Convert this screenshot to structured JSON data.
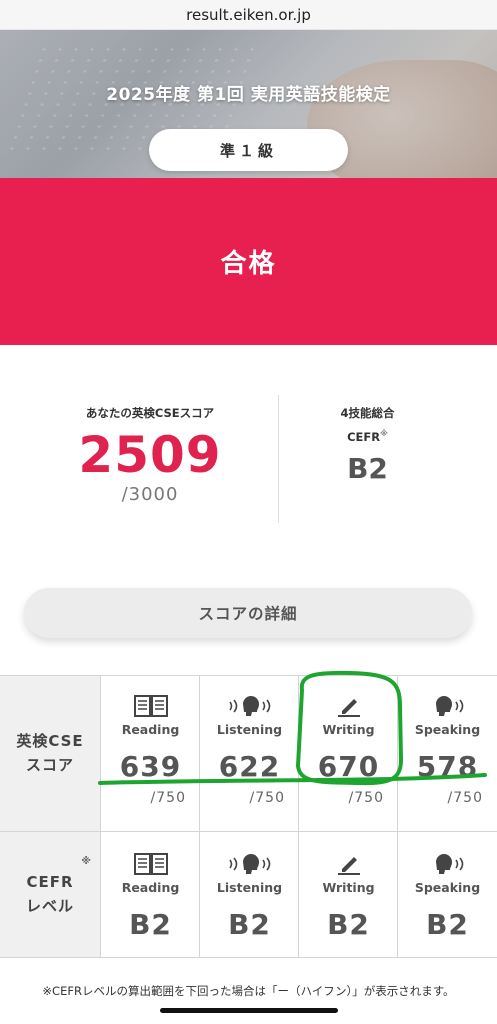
{
  "browser": {
    "url": "result.eiken.or.jp"
  },
  "hero": {
    "title": "2025年度 第1回 実用英語技能検定",
    "grade": "準１級"
  },
  "result": {
    "status": "合格"
  },
  "score": {
    "label": "あなたの英検CSEスコア",
    "total": "2509",
    "max": "/3000",
    "right_label": "4技能総合",
    "cefr_label": "CEFR",
    "cefr_note_mark": "※",
    "cefr_level": "B2"
  },
  "detail_button": {
    "label": "スコアの詳細"
  },
  "table": {
    "row_cse": {
      "header_line1": "英検CSE",
      "header_line2": "スコア"
    },
    "row_cefr": {
      "header_line1": "CEFR",
      "header_line2": "レベル",
      "note_mark": "※"
    },
    "skills": [
      {
        "name": "Reading",
        "icon": "book-icon",
        "score": "639",
        "max": "/750",
        "cefr": "B2"
      },
      {
        "name": "Listening",
        "icon": "listening-icon",
        "score": "622",
        "max": "/750",
        "cefr": "B2"
      },
      {
        "name": "Writing",
        "icon": "pencil-icon",
        "score": "670",
        "max": "/750",
        "cefr": "B2"
      },
      {
        "name": "Speaking",
        "icon": "speaking-icon",
        "score": "578",
        "max": "/750",
        "cefr": "B2"
      }
    ]
  },
  "footnote": "※CEFRレベルの算出範囲を下回った場合は「ー（ハイフン）」が表示されます。",
  "colors": {
    "accent": "#e8204f",
    "annotation": "#1ea52f"
  }
}
